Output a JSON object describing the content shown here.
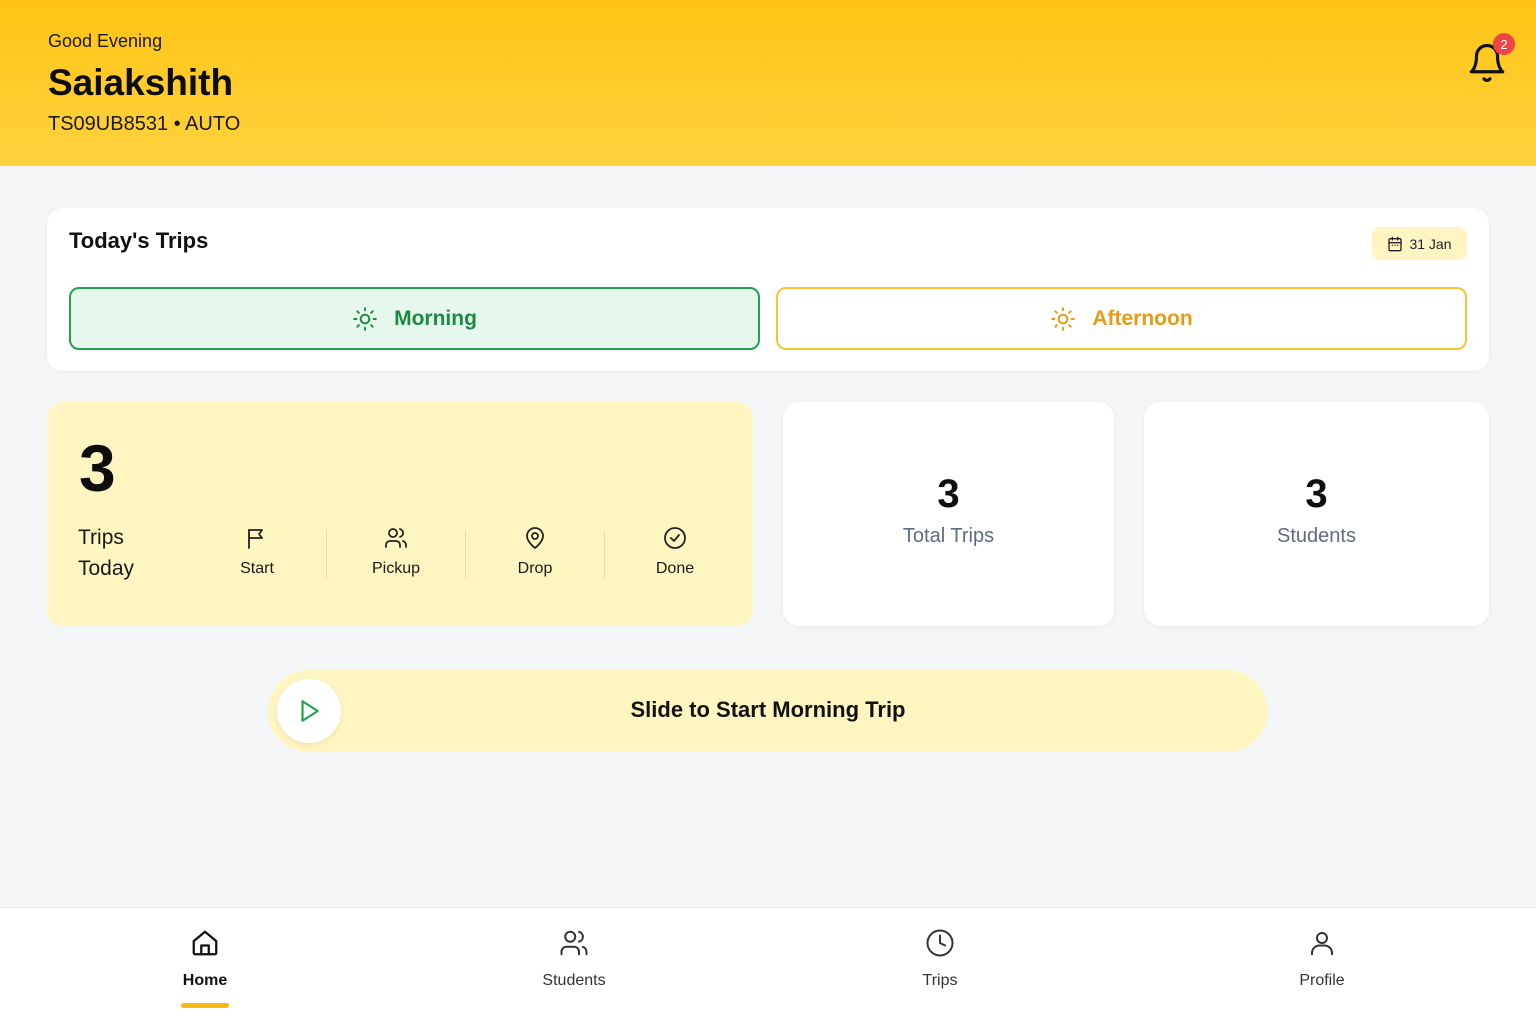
{
  "header": {
    "greeting": "Good Evening",
    "driver_name": "Saiakshith",
    "vehicle": "TS09UB8531 • AUTO",
    "notification_count": "2"
  },
  "trips": {
    "title": "Today's Trips",
    "date": "31 Jan",
    "shifts": [
      {
        "label": "Morning",
        "selected": true,
        "color": "#22a150"
      },
      {
        "label": "Afternoon",
        "selected": false,
        "color": "#e89b12"
      }
    ]
  },
  "summary": {
    "count": "3",
    "label_line1": "Trips",
    "label_line2": "Today",
    "steps": [
      {
        "label": "Start",
        "icon": "flag-icon"
      },
      {
        "label": "Pickup",
        "icon": "users-icon"
      },
      {
        "label": "Drop",
        "icon": "map-pin-icon"
      },
      {
        "label": "Done",
        "icon": "check-circle-icon"
      }
    ]
  },
  "stats": [
    {
      "value": "3",
      "label": "Total Trips"
    },
    {
      "value": "3",
      "label": "Students"
    }
  ],
  "slider": {
    "label": "Slide to Start Morning Trip",
    "icon": "play-icon"
  },
  "nav": {
    "items": [
      {
        "label": "Home",
        "icon": "home-icon",
        "active": true
      },
      {
        "label": "Students",
        "icon": "users-icon",
        "active": false
      },
      {
        "label": "Trips",
        "icon": "clock-icon",
        "active": false
      },
      {
        "label": "Profile",
        "icon": "user-icon",
        "active": false
      }
    ]
  },
  "colors": {
    "header_yellow": "#ffc414",
    "accent_green": "#22a150",
    "accent_orange": "#e89b12",
    "soft_yellow": "#fff5c0",
    "badge_red": "#ef4444",
    "muted_text": "#5d6b85"
  }
}
